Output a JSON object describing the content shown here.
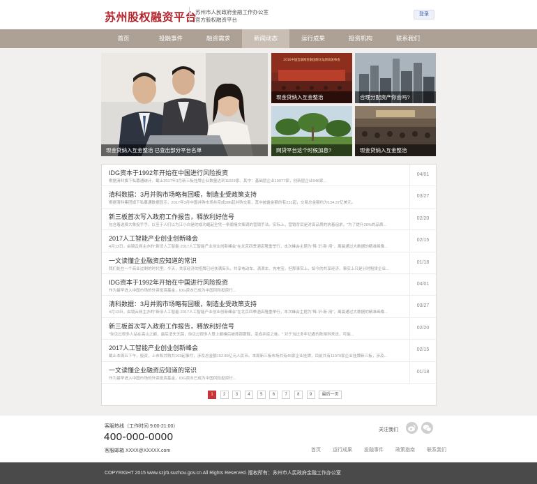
{
  "header": {
    "logo": "苏州股权融资平台",
    "org_line1": "苏州市人民政府金融工作办公室",
    "org_line2": "官方股权融资平台",
    "login": "登录"
  },
  "nav": [
    "首页",
    "投融事件",
    "融资需求",
    "新闻动态",
    "运行成果",
    "投资机构",
    "联系我们"
  ],
  "banner": {
    "main_caption": "现金贷纳入互金整治 已查出部分平台名单",
    "tiles": [
      "现金贷纳入互金整治",
      "合理分配资产你会吗?",
      "网贷平台这个时候加息?",
      "现金贷纳入互金整治"
    ],
    "tile_image_text": "2016中国互联网金融国际论坛新闻发布会"
  },
  "news": [
    {
      "title": "IDG资本于1992年开始在中国进行风险投资",
      "summary": "根据清科旗下私募通统计，截止2017年3月新三板挂牌企业数量达到11023家。其中：基础层企业10077家，创新层企业946家...",
      "date": "04/01"
    },
    {
      "title": "清科数据：3月并购市场略有回暖，制造业受政策支持",
      "summary": "根据清科集团旗下私募通数据显示，2017年3月中国并购市场共完成286起并购交易，其中披露金额的有231起，交易总金额约为134.37亿美元。",
      "date": "03/27"
    },
    {
      "title": "新三板首次写入政府工作报告，释放利好信号",
      "summary": "包含着选择大象投手手，以至于人们以为江小白是的成功崛起全凭一条煽情文案调的营销手法。实际上，营销背后是对高品质的执着追求，\"为了提升20%的品质...",
      "date": "02/20"
    },
    {
      "title": "2017人工智能产业创业创新峰会",
      "summary": "4月13日，由镜云网主办的\"新旧人工智能·2017人工智能产业创业创新峰会\"在北京四季酒店隆重举行，本次峰会主题为\"降·识·新·用\"，离晨通过大数据的精准画像...",
      "date": "02/15"
    },
    {
      "title": "一文读懂企业融资应知道的常识",
      "summary": "我们处在一个商业过剩的时代里。今天，共享经济的招牌已经扶满街头，共享电动车、滴滴车、充电宝。但那事实上，如今的共享经济，事实上只是分时租赁企业...",
      "date": "01/18"
    },
    {
      "title": "IDG资本于1992年开始在中国进行风险投资",
      "summary": "作为最早进入中国市场的外资投资基金，IDG资本已成为中国风险投资行...",
      "date": "04/01"
    },
    {
      "title": "清科数据：3月并购市场略有回暖，制造业受政策支持",
      "summary": "4月13日，由镜云网主办的\"新旧人工智能·2017人工智能产业创业创新峰会\"在北京四季酒店隆重举行，本次峰会主题为\"降·识·新·用\"，离晨通过大数据的精准画像...",
      "date": "03/27"
    },
    {
      "title": "新三板首次写入政府工作报告，释放利好信号",
      "summary": "\"你见过很多人站在高山之巅，最后消失无踪，你见过很多人登上巅峰后被摔那跟鞋，变成井底之蛙。\" 对于当过多年记者的陈晓科来说，可能...",
      "date": "02/20"
    },
    {
      "title": "2017人工智能产业创业创新峰会",
      "summary": "截止本周五下午，投资，上市和并购共103起事件，涉及总金额152.89亿元人民币。本周新三板市场共有45家企业挂牌，目前共有11070家企业挂牌新三板，涉及...",
      "date": "02/15"
    },
    {
      "title": "一文读懂企业融资应知道的常识",
      "summary": "作为最早进入中国市场的外资投资基金，IDG资本已成为中国风险投资行...",
      "date": "01/18"
    }
  ],
  "pager": {
    "pages": [
      "1",
      "2",
      "3",
      "4",
      "5",
      "6",
      "7",
      "8",
      "9"
    ],
    "last": "最后一页"
  },
  "footer": {
    "hotline_label": "客服热线（工作时间 9:00-21:00）",
    "phone": "400-000-0000",
    "email": "客服邮箱 XXXX@XXXXX.com",
    "follow": "关注我们",
    "links": [
      "首页",
      "运行成果",
      "投融事件",
      "政策指南",
      "联系我们"
    ],
    "copyright": "COPYRIGHT 2015 www.szjrb.suzhou.gov.cn All Rights Reserved.  版权所有：苏州市人民政府金融工作办公室"
  },
  "colors": {
    "brand": "#b3262e",
    "nav": "#ada094",
    "nav_active": "#c9beb3",
    "page_active": "#c8333a"
  }
}
